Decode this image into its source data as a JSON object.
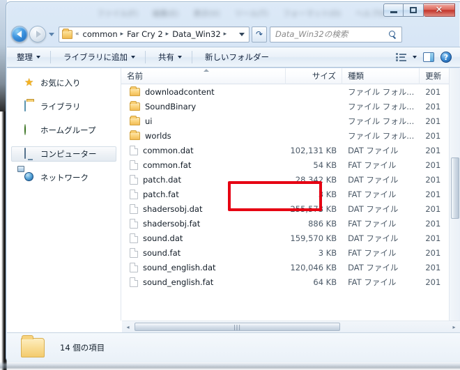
{
  "window": {
    "menu_ghost_items": [
      "ファイル(F)",
      "編集(E)",
      "表示(V)",
      "ツール(T)",
      "フォーマット(O)",
      "ヘルプ(H)"
    ],
    "minimize_label": "—",
    "maximize_label": "□",
    "close_label": "✕"
  },
  "nav": {
    "back_label": "戻る",
    "forward_label": "進む",
    "history_label": "最近表示した場所",
    "refresh_label": "更新",
    "breadcrumb": {
      "overflow": "«",
      "items": [
        "common",
        "Far Cry 2",
        "Data_Win32"
      ],
      "separator": "▸",
      "dropdown": "▼"
    },
    "search": {
      "placeholder": "Data_Win32の検索",
      "icon": "search-icon"
    }
  },
  "toolbar": {
    "items": [
      {
        "label": "整理",
        "has_caret": true
      },
      {
        "label": "ライブラリに追加",
        "has_caret": true
      },
      {
        "label": "共有",
        "has_caret": true
      },
      {
        "label": "新しいフォルダー",
        "has_caret": false
      }
    ],
    "view_label": "表示方法の変更",
    "view_caret": "▼",
    "preview_label": "プレビュー ウィンドウ",
    "help_label": "?"
  },
  "sidebar": {
    "items": [
      {
        "label": "お気に入り",
        "icon": "star-icon",
        "selected": false
      },
      {
        "label": "ライブラリ",
        "icon": "library-icon",
        "selected": false
      },
      {
        "label": "ホームグループ",
        "icon": "homegroup-icon",
        "selected": false
      },
      {
        "label": "コンピューター",
        "icon": "computer-icon",
        "selected": true
      },
      {
        "label": "ネットワーク",
        "icon": "network-icon",
        "selected": false
      }
    ]
  },
  "filelist": {
    "columns": [
      {
        "label": "名前",
        "sorted": "asc"
      },
      {
        "label": "サイズ",
        "sorted": null
      },
      {
        "label": "種類",
        "sorted": null
      },
      {
        "label": "更新",
        "sorted": null
      }
    ],
    "rows": [
      {
        "name": "downloadcontent",
        "size": "",
        "type": "ファイル フォル...",
        "date": "201",
        "icon": "folder-icon"
      },
      {
        "name": "SoundBinary",
        "size": "",
        "type": "ファイル フォル...",
        "date": "201",
        "icon": "folder-icon"
      },
      {
        "name": "ui",
        "size": "",
        "type": "ファイル フォル...",
        "date": "201",
        "icon": "folder-icon"
      },
      {
        "name": "worlds",
        "size": "",
        "type": "ファイル フォル...",
        "date": "201",
        "icon": "folder-icon"
      },
      {
        "name": "common.dat",
        "size": "102,131 KB",
        "type": "DAT ファイル",
        "date": "201",
        "icon": "file-icon"
      },
      {
        "name": "common.fat",
        "size": "54 KB",
        "type": "FAT ファイル",
        "date": "201",
        "icon": "file-icon"
      },
      {
        "name": "patch.dat",
        "size": "28,342 KB",
        "type": "DAT ファイル",
        "date": "201",
        "icon": "file-icon"
      },
      {
        "name": "patch.fat",
        "size": "3 KB",
        "type": "FAT ファイル",
        "date": "201",
        "icon": "file-icon"
      },
      {
        "name": "shadersobj.dat",
        "size": "255,573 KB",
        "type": "DAT ファイル",
        "date": "201",
        "icon": "file-icon"
      },
      {
        "name": "shadersobj.fat",
        "size": "886 KB",
        "type": "FAT ファイル",
        "date": "201",
        "icon": "file-icon"
      },
      {
        "name": "sound.dat",
        "size": "159,570 KB",
        "type": "DAT ファイル",
        "date": "201",
        "icon": "file-icon"
      },
      {
        "name": "sound.fat",
        "size": "3 KB",
        "type": "FAT ファイル",
        "date": "201",
        "icon": "file-icon"
      },
      {
        "name": "sound_english.dat",
        "size": "120,046 KB",
        "type": "DAT ファイル",
        "date": "201",
        "icon": "file-icon"
      },
      {
        "name": "sound_english.fat",
        "size": "64 KB",
        "type": "FAT ファイル",
        "date": "201",
        "icon": "file-icon"
      }
    ]
  },
  "annotation": {
    "color": "#e60012",
    "targets": [
      "patch.dat",
      "patch.fat"
    ]
  },
  "scrollbars": {
    "h_left_arrow": "◂",
    "h_right_arrow": "▸",
    "h_grip": "|||"
  },
  "statusbar": {
    "text": "14 個の項目",
    "icon": "folder-icon"
  }
}
